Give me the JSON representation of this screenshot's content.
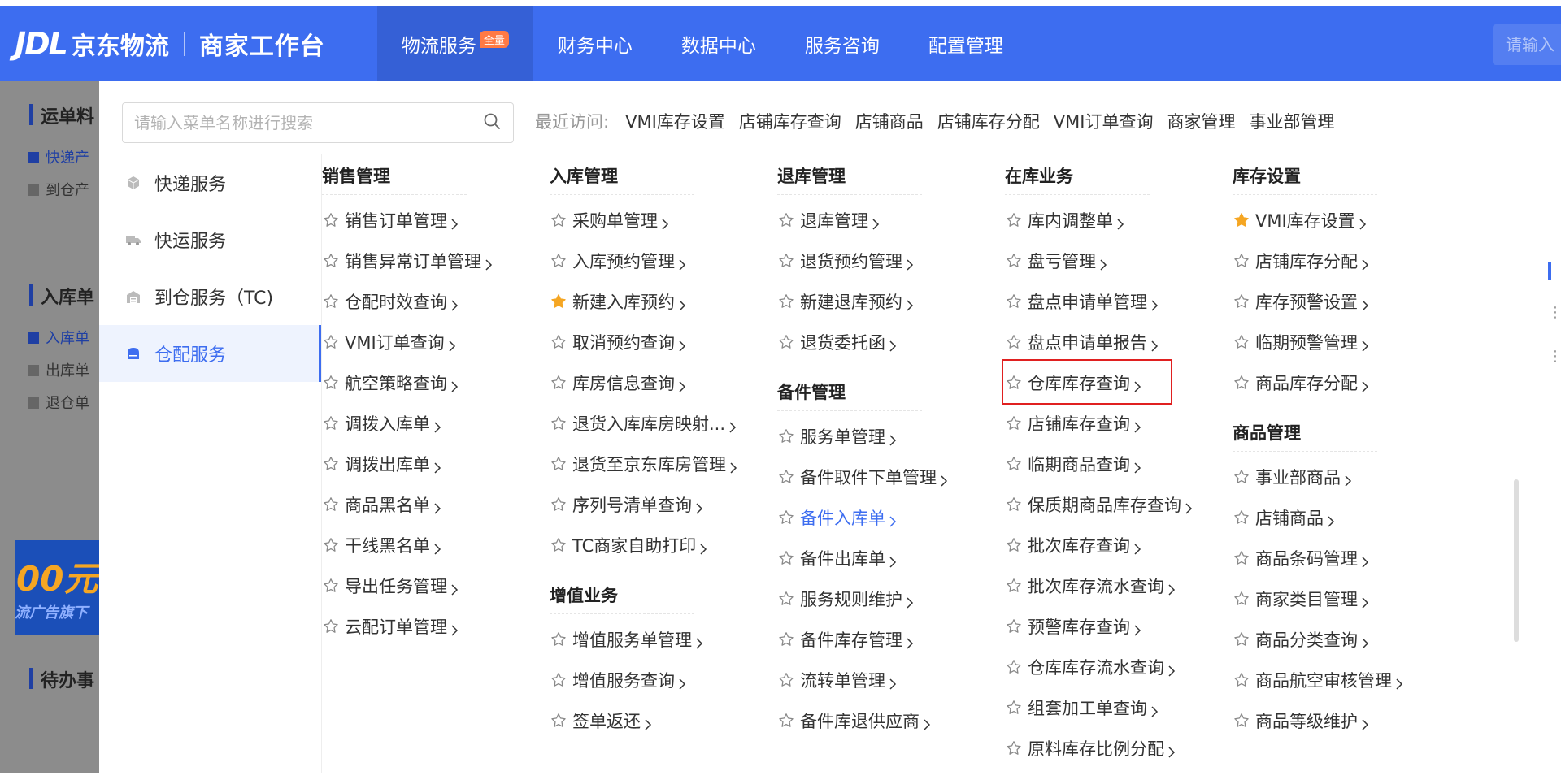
{
  "header": {
    "logo_en": "JDL",
    "logo_cn": "京东物流",
    "logo_sub": "商家工作台",
    "nav": [
      {
        "label": "物流服务",
        "badge": "全量",
        "active": true
      },
      {
        "label": "财务中心"
      },
      {
        "label": "数据中心"
      },
      {
        "label": "服务咨询"
      },
      {
        "label": "配置管理"
      }
    ],
    "search_placeholder": "请输入"
  },
  "background": {
    "titles": [
      "运单料",
      "入库单",
      "待办事"
    ],
    "links": [
      "快递产",
      "到仓产",
      "入库单",
      "出库单",
      "退仓单"
    ],
    "banner_text": "00元",
    "banner_sub": "流广告旗下"
  },
  "menu": {
    "search_placeholder": "请输入菜单名称进行搜索",
    "recent_label": "最近访问:",
    "recent": [
      "VMI库存设置",
      "店铺库存查询",
      "店铺商品",
      "店铺库存分配",
      "VMI订单查询",
      "商家管理",
      "事业部管理"
    ],
    "categories": [
      {
        "label": "快递服务",
        "icon": "box-icon"
      },
      {
        "label": "快运服务",
        "icon": "truck-icon"
      },
      {
        "label": "到仓服务（TC)",
        "icon": "warehouse-icon"
      },
      {
        "label": "仓配服务",
        "icon": "storage-icon",
        "active": true
      }
    ],
    "columns": [
      {
        "groups": [
          {
            "title": "销售管理",
            "items": [
              "销售订单管理",
              "销售异常订单管理",
              "仓配时效查询",
              "VMI订单查询",
              "航空策略查询",
              "调拨入库单",
              "调拨出库单",
              "商品黑名单",
              "干线黑名单",
              "导出任务管理",
              "云配订单管理"
            ]
          }
        ]
      },
      {
        "groups": [
          {
            "title": "入库管理",
            "items": [
              "采购单管理",
              "入库预约管理",
              "新建入库预约",
              "取消预约查询",
              "库房信息查询",
              "退货入库库房映射...",
              "退货至京东库房管理",
              "序列号清单查询",
              "TC商家自助打印"
            ]
          },
          {
            "title": "增值业务",
            "items": [
              "增值服务单管理",
              "增值服务查询",
              "签单返还"
            ]
          }
        ]
      },
      {
        "groups": [
          {
            "title": "退库管理",
            "items": [
              "退库管理",
              "退货预约管理",
              "新建退库预约",
              "退货委托函"
            ]
          },
          {
            "title": "备件管理",
            "items": [
              "服务单管理",
              "备件取件下单管理",
              "备件入库单",
              "备件出库单",
              "服务规则维护",
              "备件库存管理",
              "流转单管理",
              "备件库退供应商"
            ]
          }
        ]
      },
      {
        "groups": [
          {
            "title": "在库业务",
            "items": [
              "库内调整单",
              "盘亏管理",
              "盘点申请单管理",
              "盘点申请单报告",
              "仓库库存查询",
              "店铺库存查询",
              "临期商品查询",
              "保质期商品库存查询",
              "批次库存查询",
              "批次库存流水查询",
              "预警库存查询",
              "仓库库存流水查询",
              "组套加工单查询",
              "原料库存比例分配"
            ]
          }
        ]
      },
      {
        "groups": [
          {
            "title": "库存设置",
            "items": [
              "VMI库存设置",
              "店铺库存分配",
              "库存预警设置",
              "临期预警管理",
              "商品库存分配"
            ]
          },
          {
            "title": "商品管理",
            "items": [
              "事业部商品",
              "店铺商品",
              "商品条码管理",
              "商家类目管理",
              "商品分类查询",
              "商品航空审核管理",
              "商品等级维护"
            ]
          }
        ]
      }
    ],
    "starred": [
      "新建入库预约",
      "VMI库存设置"
    ],
    "link_items": [
      "备件入库单"
    ],
    "highlighted": [
      "仓库库存查询"
    ],
    "colors": {
      "primary": "#3d6df0",
      "star": "#f5a623",
      "highlight": "#e02020"
    }
  }
}
